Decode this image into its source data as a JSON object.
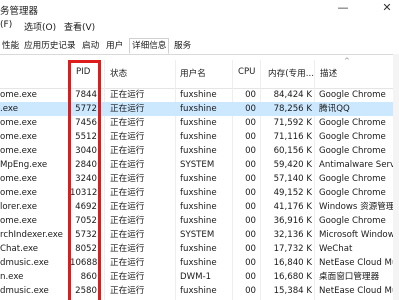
{
  "window": {
    "title": "务管理器",
    "minimize_glyph": "—",
    "close_glyph": "✕"
  },
  "menu": [
    "(F)",
    "选项(O)",
    "查看(V)"
  ],
  "tabs": [
    "性能",
    "应用历史记录",
    "启动",
    "用户",
    "详细信息",
    "服务"
  ],
  "active_tab": "详细信息",
  "columns": {
    "name": "",
    "pid": "PID",
    "status": "状态",
    "user": "用户名",
    "cpu": "CPU",
    "mem": "内存(专用...",
    "desc": "描述"
  },
  "sort_glyph": "^",
  "rows": [
    {
      "name": "ome.exe",
      "pid": "7844",
      "status": "正在运行",
      "user": "fuxshine",
      "cpu": "00",
      "mem": "84,424 K",
      "desc": "Google Chrome"
    },
    {
      "name": ".exe",
      "pid": "5772",
      "status": "正在运行",
      "user": "fuxshine",
      "cpu": "00",
      "mem": "78,256 K",
      "desc": "腾讯QQ",
      "selected": true
    },
    {
      "name": "ome.exe",
      "pid": "7456",
      "status": "正在运行",
      "user": "fuxshine",
      "cpu": "00",
      "mem": "71,592 K",
      "desc": "Google Chrome"
    },
    {
      "name": "ome.exe",
      "pid": "5512",
      "status": "正在运行",
      "user": "fuxshine",
      "cpu": "00",
      "mem": "71,116 K",
      "desc": "Google Chrome"
    },
    {
      "name": "ome.exe",
      "pid": "3040",
      "status": "正在运行",
      "user": "fuxshine",
      "cpu": "00",
      "mem": "60,156 K",
      "desc": "Google Chrome"
    },
    {
      "name": "MpEng.exe",
      "pid": "2840",
      "status": "正在运行",
      "user": "SYSTEM",
      "cpu": "00",
      "mem": "59,420 K",
      "desc": "Antimalware Service"
    },
    {
      "name": "ome.exe",
      "pid": "3240",
      "status": "正在运行",
      "user": "fuxshine",
      "cpu": "00",
      "mem": "57,140 K",
      "desc": "Google Chrome"
    },
    {
      "name": "ome.exe",
      "pid": "10312",
      "status": "正在运行",
      "user": "fuxshine",
      "cpu": "00",
      "mem": "49,152 K",
      "desc": "Google Chrome"
    },
    {
      "name": "lorer.exe",
      "pid": "4692",
      "status": "正在运行",
      "user": "fuxshine",
      "cpu": "00",
      "mem": "41,176 K",
      "desc": "Windows 资源管理器"
    },
    {
      "name": "ome.exe",
      "pid": "7052",
      "status": "正在运行",
      "user": "fuxshine",
      "cpu": "00",
      "mem": "36,916 K",
      "desc": "Google Chrome"
    },
    {
      "name": "rchIndexer.exe",
      "pid": "5732",
      "status": "正在运行",
      "user": "SYSTEM",
      "cpu": "00",
      "mem": "32,136 K",
      "desc": "Microsoft Windows"
    },
    {
      "name": "Chat.exe",
      "pid": "8052",
      "status": "正在运行",
      "user": "fuxshine",
      "cpu": "00",
      "mem": "17,732 K",
      "desc": "WeChat"
    },
    {
      "name": "dmusic.exe",
      "pid": "10688",
      "status": "正在运行",
      "user": "fuxshine",
      "cpu": "00",
      "mem": "16,840 K",
      "desc": "NetEase Cloud Music"
    },
    {
      "name": "n.exe",
      "pid": "860",
      "status": "正在运行",
      "user": "DWM-1",
      "cpu": "00",
      "mem": "16,680 K",
      "desc": "桌面窗口管理器"
    },
    {
      "name": "dmusic.exe",
      "pid": "2580",
      "status": "正在运行",
      "user": "fuxshine",
      "cpu": "00",
      "mem": "15,384 K",
      "desc": "NetEase Cloud Music"
    }
  ],
  "colors": {
    "selection": "#cce8ff",
    "highlight_box": "#e01b1b"
  }
}
